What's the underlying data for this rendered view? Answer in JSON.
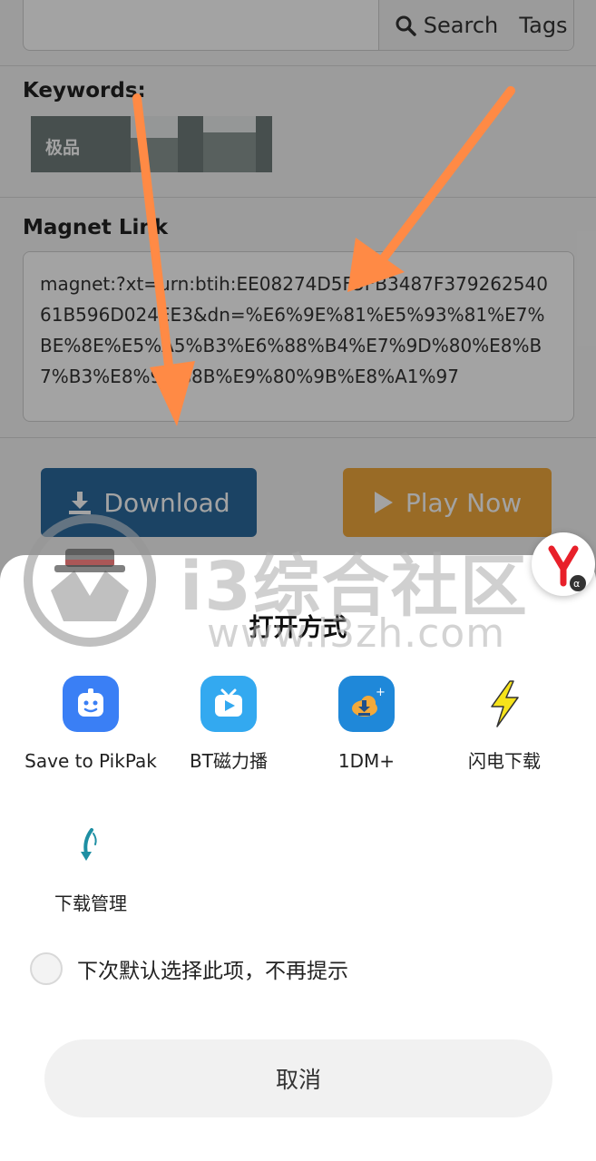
{
  "header": {
    "search_label": "Search",
    "tags_label": "Tags"
  },
  "keywords": {
    "title": "Keywords:",
    "chip_text": "极品"
  },
  "magnet": {
    "title": "Magnet Link",
    "value": "magnet:?xt=urn:btih:EE08274D5F5FB3487F37926254061B596D024EE3&dn=%E6%9E%81%E5%93%81%E7%BE%8E%E5%A5%B3%E6%88%B4%E7%9D%80%E8%B7%B3%E8%9B%8B%E9%80%9B%E8%A1%97"
  },
  "buttons": {
    "download": "Download",
    "play_now": "Play Now"
  },
  "watermark": {
    "main": "i3综合社区",
    "sub": "www.i3zh.com"
  },
  "sheet": {
    "title": "打开方式",
    "apps": [
      {
        "label": "Save to PikPak",
        "icon": "pikpak-icon"
      },
      {
        "label": "BT磁力播",
        "icon": "tv-play-icon"
      },
      {
        "label": "1DM+",
        "icon": "cloud-download-icon"
      },
      {
        "label": "闪电下载",
        "icon": "lightning-icon"
      },
      {
        "label": "下载管理",
        "icon": "download-manager-icon"
      }
    ],
    "remember_label": "下次默认选择此项，不再提示",
    "cancel_label": "取消"
  },
  "colors": {
    "download_button": "#2b6a9d",
    "play_button": "#f0a83c",
    "arrow": "#ff8a45",
    "pikpak": "#3a7ff5",
    "bt": "#33a9f0",
    "onedm": "#1f88d9",
    "lightning": "#f6e31a"
  }
}
